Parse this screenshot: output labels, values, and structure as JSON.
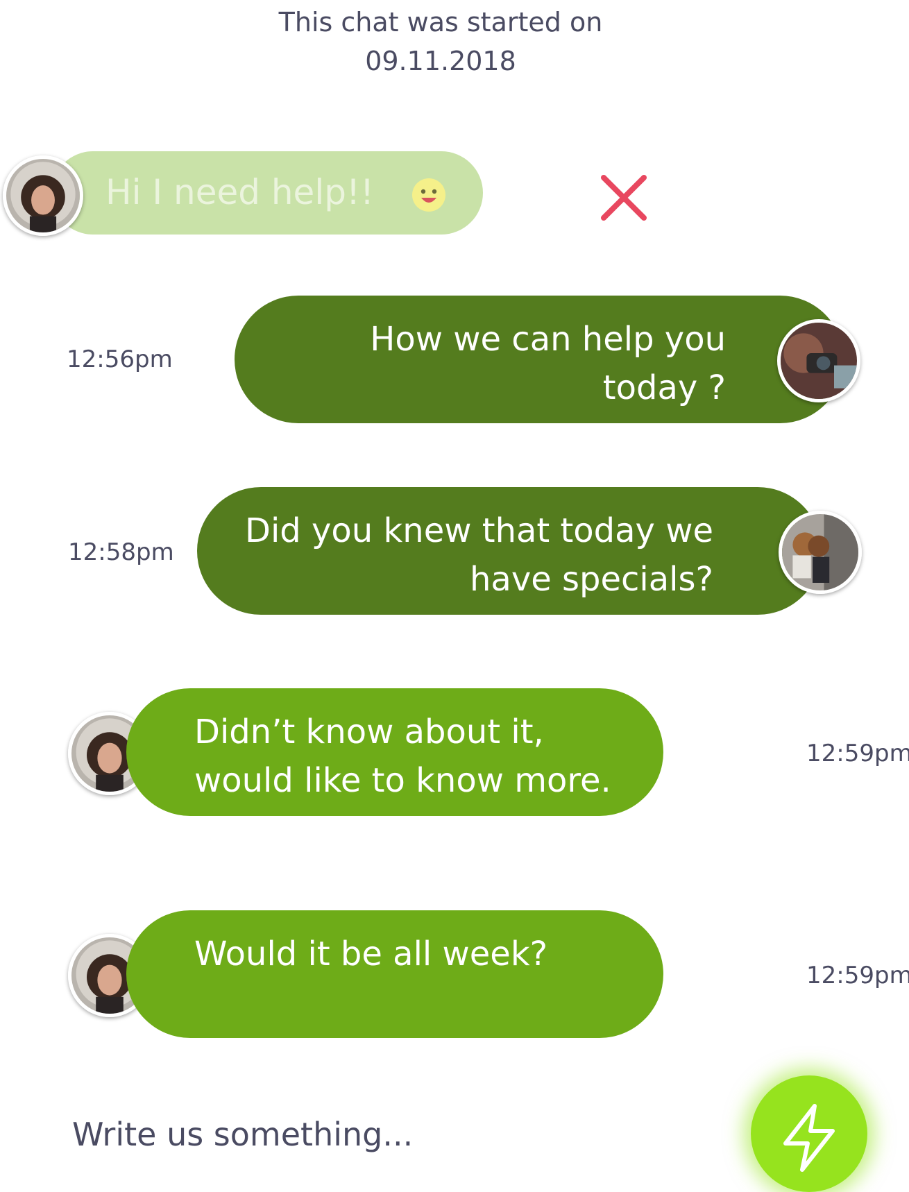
{
  "header": {
    "line1": "This chat was started on",
    "line2": "09.11.2018"
  },
  "messages": [
    {
      "sender": "user",
      "lines": [
        "Hi I need help!!"
      ],
      "status": "failed",
      "icon": "smile-emoji-icon",
      "action_icon": "close-icon"
    },
    {
      "sender": "agent",
      "lines": [
        "How  we can help you",
        "today ?"
      ],
      "time": "12:56pm"
    },
    {
      "sender": "agent",
      "lines": [
        "Did you knew that today we",
        "have specials?"
      ],
      "time": "12:58pm"
    },
    {
      "sender": "user",
      "lines": [
        "Didn’t know about it,",
        "would like to know more."
      ],
      "time": "12:59pm"
    },
    {
      "sender": "user",
      "lines": [
        "Would it be all week?"
      ],
      "time": "12:59pm"
    }
  ],
  "compose": {
    "placeholder": "Write us something...",
    "value": ""
  },
  "send_button": {
    "icon": "lightning-bolt-icon"
  },
  "colors": {
    "failed_bubble": "#c9e2a8",
    "agent_bubble": "#547c1e",
    "user_bubble": "#6eac18",
    "send_button": "#96e31e",
    "close_icon": "#e8475f",
    "text_dark": "#4a4b62"
  }
}
